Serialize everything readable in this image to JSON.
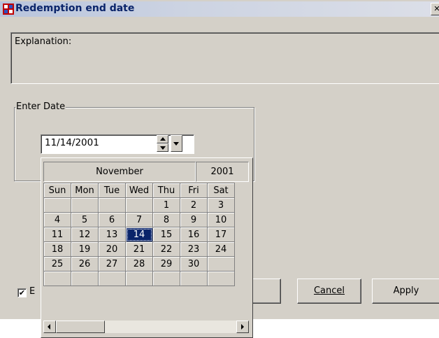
{
  "window": {
    "title": "Redemption end date",
    "close_label": "✕"
  },
  "explanation": {
    "label": "Explanation:"
  },
  "date_group": {
    "title": "Enter Date",
    "value": "11/14/2001"
  },
  "calendar": {
    "month": "November",
    "year": "2001",
    "day_headers": [
      "Sun",
      "Mon",
      "Tue",
      "Wed",
      "Thu",
      "Fri",
      "Sat"
    ],
    "weeks": [
      [
        "",
        "",
        "",
        "",
        "1",
        "2",
        "3"
      ],
      [
        "4",
        "5",
        "6",
        "7",
        "8",
        "9",
        "10"
      ],
      [
        "11",
        "12",
        "13",
        "14",
        "15",
        "16",
        "17"
      ],
      [
        "18",
        "19",
        "20",
        "21",
        "22",
        "23",
        "24"
      ],
      [
        "25",
        "26",
        "27",
        "28",
        "29",
        "30",
        ""
      ],
      [
        "",
        "",
        "",
        "",
        "",
        "",
        ""
      ]
    ],
    "selected_day": "14"
  },
  "checkbox": {
    "checked": true,
    "label_visible": "E"
  },
  "buttons": {
    "cancel": "Cancel",
    "apply": "Apply"
  },
  "colors": {
    "selection": "#0a246a",
    "face": "#d4d0c8",
    "title_text": "#0a246a"
  }
}
